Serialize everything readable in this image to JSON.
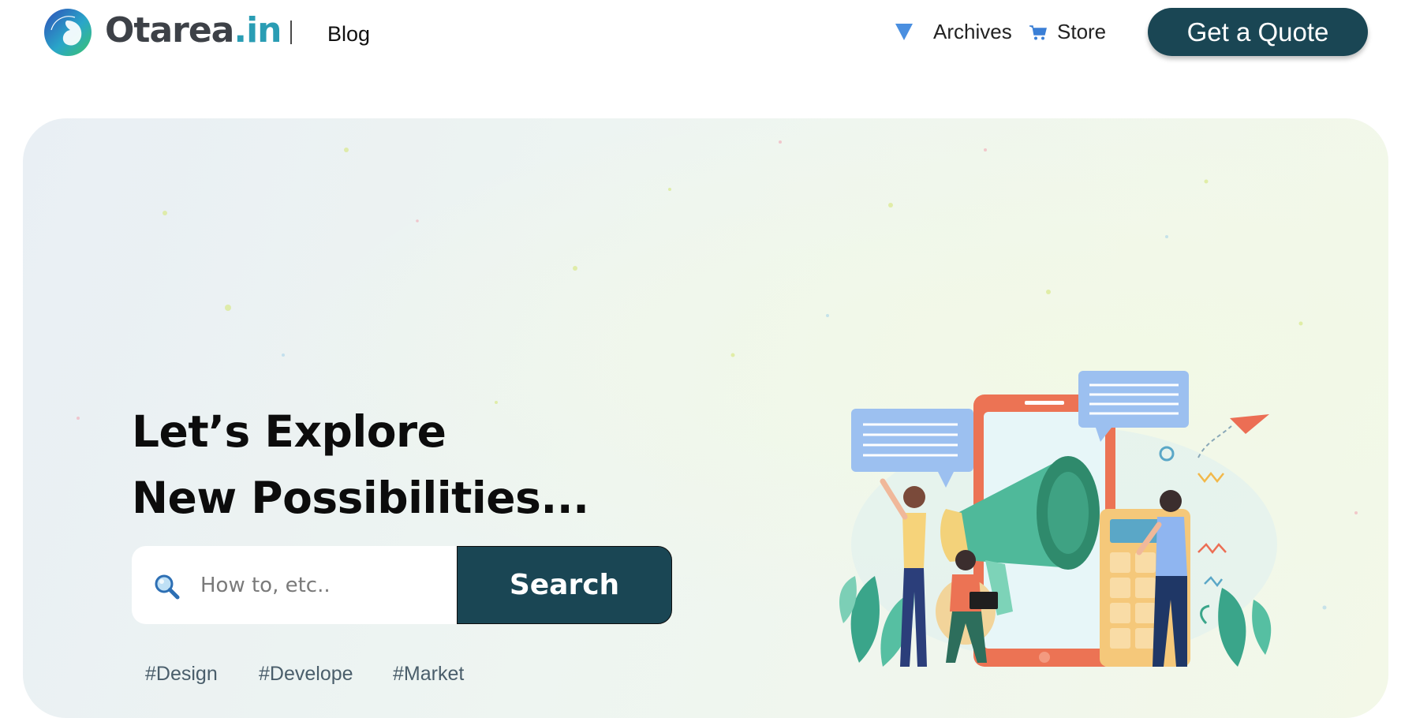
{
  "header": {
    "brand_name": "Otarea",
    "brand_tld": ".in",
    "logo_text": "Otarea",
    "section": "Blog",
    "nav": [
      {
        "label": "Archives",
        "icon": "triangle-down-icon"
      },
      {
        "label": "Store",
        "icon": "cart-icon"
      }
    ],
    "cta_label": "Get a Quote"
  },
  "hero": {
    "headline_line1": "Let’s Explore",
    "headline_line2": "New Possibilities...",
    "search": {
      "placeholder": "How to, etc..",
      "value": "",
      "button_label": "Search"
    },
    "tags": [
      "#Design",
      "#Develope",
      "#Market"
    ]
  },
  "colors": {
    "brand_dark": "#1a4654",
    "brand_teal": "#2a9db4",
    "nav_icon_blue": "#4a8fe0"
  }
}
